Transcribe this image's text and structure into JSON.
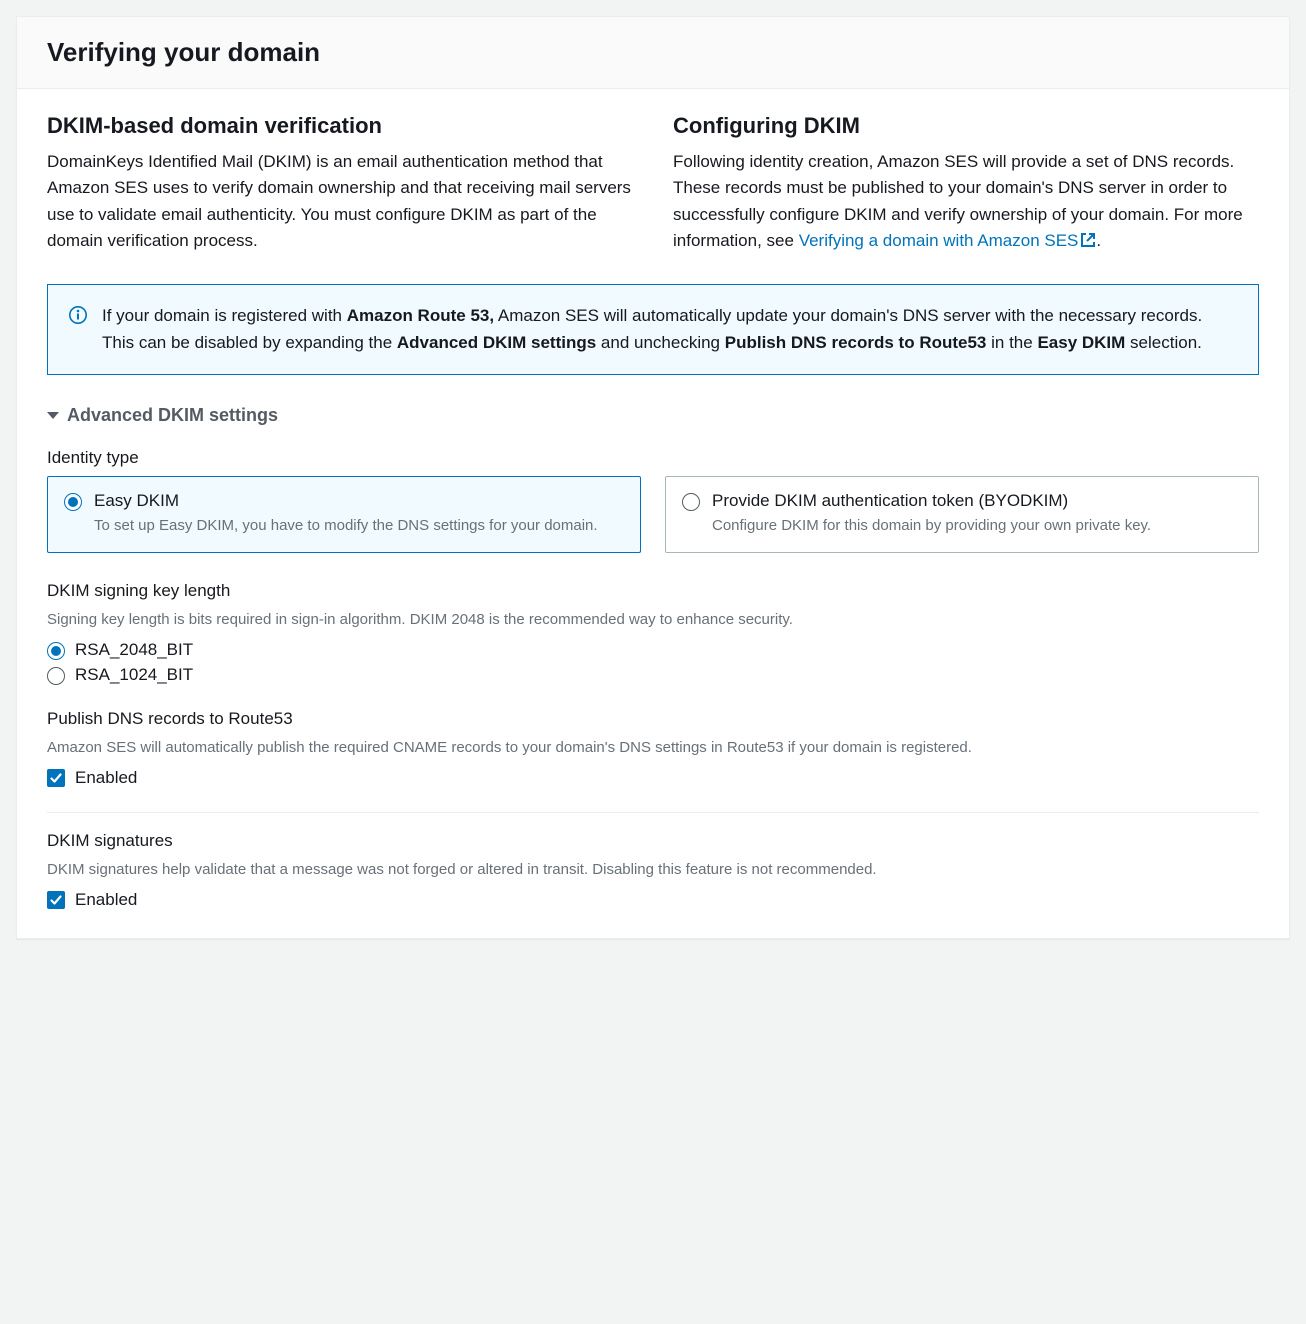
{
  "header": {
    "title": "Verifying your domain"
  },
  "section_dkim": {
    "title": "DKIM-based domain verification",
    "body": "DomainKeys Identified Mail (DKIM) is an email authentication method that Amazon SES uses to verify domain ownership and that receiving mail servers use to validate email authenticity. You must configure DKIM as part of the domain verification process."
  },
  "section_configure": {
    "title": "Configuring DKIM",
    "body_pre": "Following identity creation, Amazon SES will provide a set of DNS records. These records must be published to your domain's DNS server in order to successfully configure DKIM and verify ownership of your domain. For more information, see ",
    "link_text": "Verifying a domain with Amazon SES",
    "body_post": "."
  },
  "info": {
    "part1": "If your domain is registered with ",
    "bold1": "Amazon Route 53,",
    "part2": " Amazon SES will automatically update your domain's DNS server with the necessary records. This can be disabled by expanding the ",
    "bold2": "Advanced DKIM settings",
    "part3": " and unchecking ",
    "bold3": "Publish DNS records to Route53",
    "part4": " in the ",
    "bold4": "Easy DKIM",
    "part5": " selection."
  },
  "advanced": {
    "title": "Advanced DKIM settings"
  },
  "identity_type": {
    "label": "Identity type",
    "options": [
      {
        "title": "Easy DKIM",
        "desc": "To set up Easy DKIM, you have to modify the DNS settings for your domain.",
        "selected": true
      },
      {
        "title": "Provide DKIM authentication token (BYODKIM)",
        "desc": "Configure DKIM for this domain by providing your own private key.",
        "selected": false
      }
    ]
  },
  "key_length": {
    "label": "DKIM signing key length",
    "hint": "Signing key length is bits required in sign-in algorithm. DKIM 2048 is the recommended way to enhance security.",
    "options": [
      {
        "label": "RSA_2048_BIT",
        "selected": true
      },
      {
        "label": "RSA_1024_BIT",
        "selected": false
      }
    ]
  },
  "publish_dns": {
    "label": "Publish DNS records to Route53",
    "hint": "Amazon SES will automatically publish the required CNAME records to your domain's DNS settings in Route53 if your domain is registered.",
    "checkbox_label": "Enabled",
    "checked": true
  },
  "signatures": {
    "label": "DKIM signatures",
    "hint": "DKIM signatures help validate that a message was not forged or altered in transit. Disabling this feature is not recommended.",
    "checkbox_label": "Enabled",
    "checked": true
  }
}
